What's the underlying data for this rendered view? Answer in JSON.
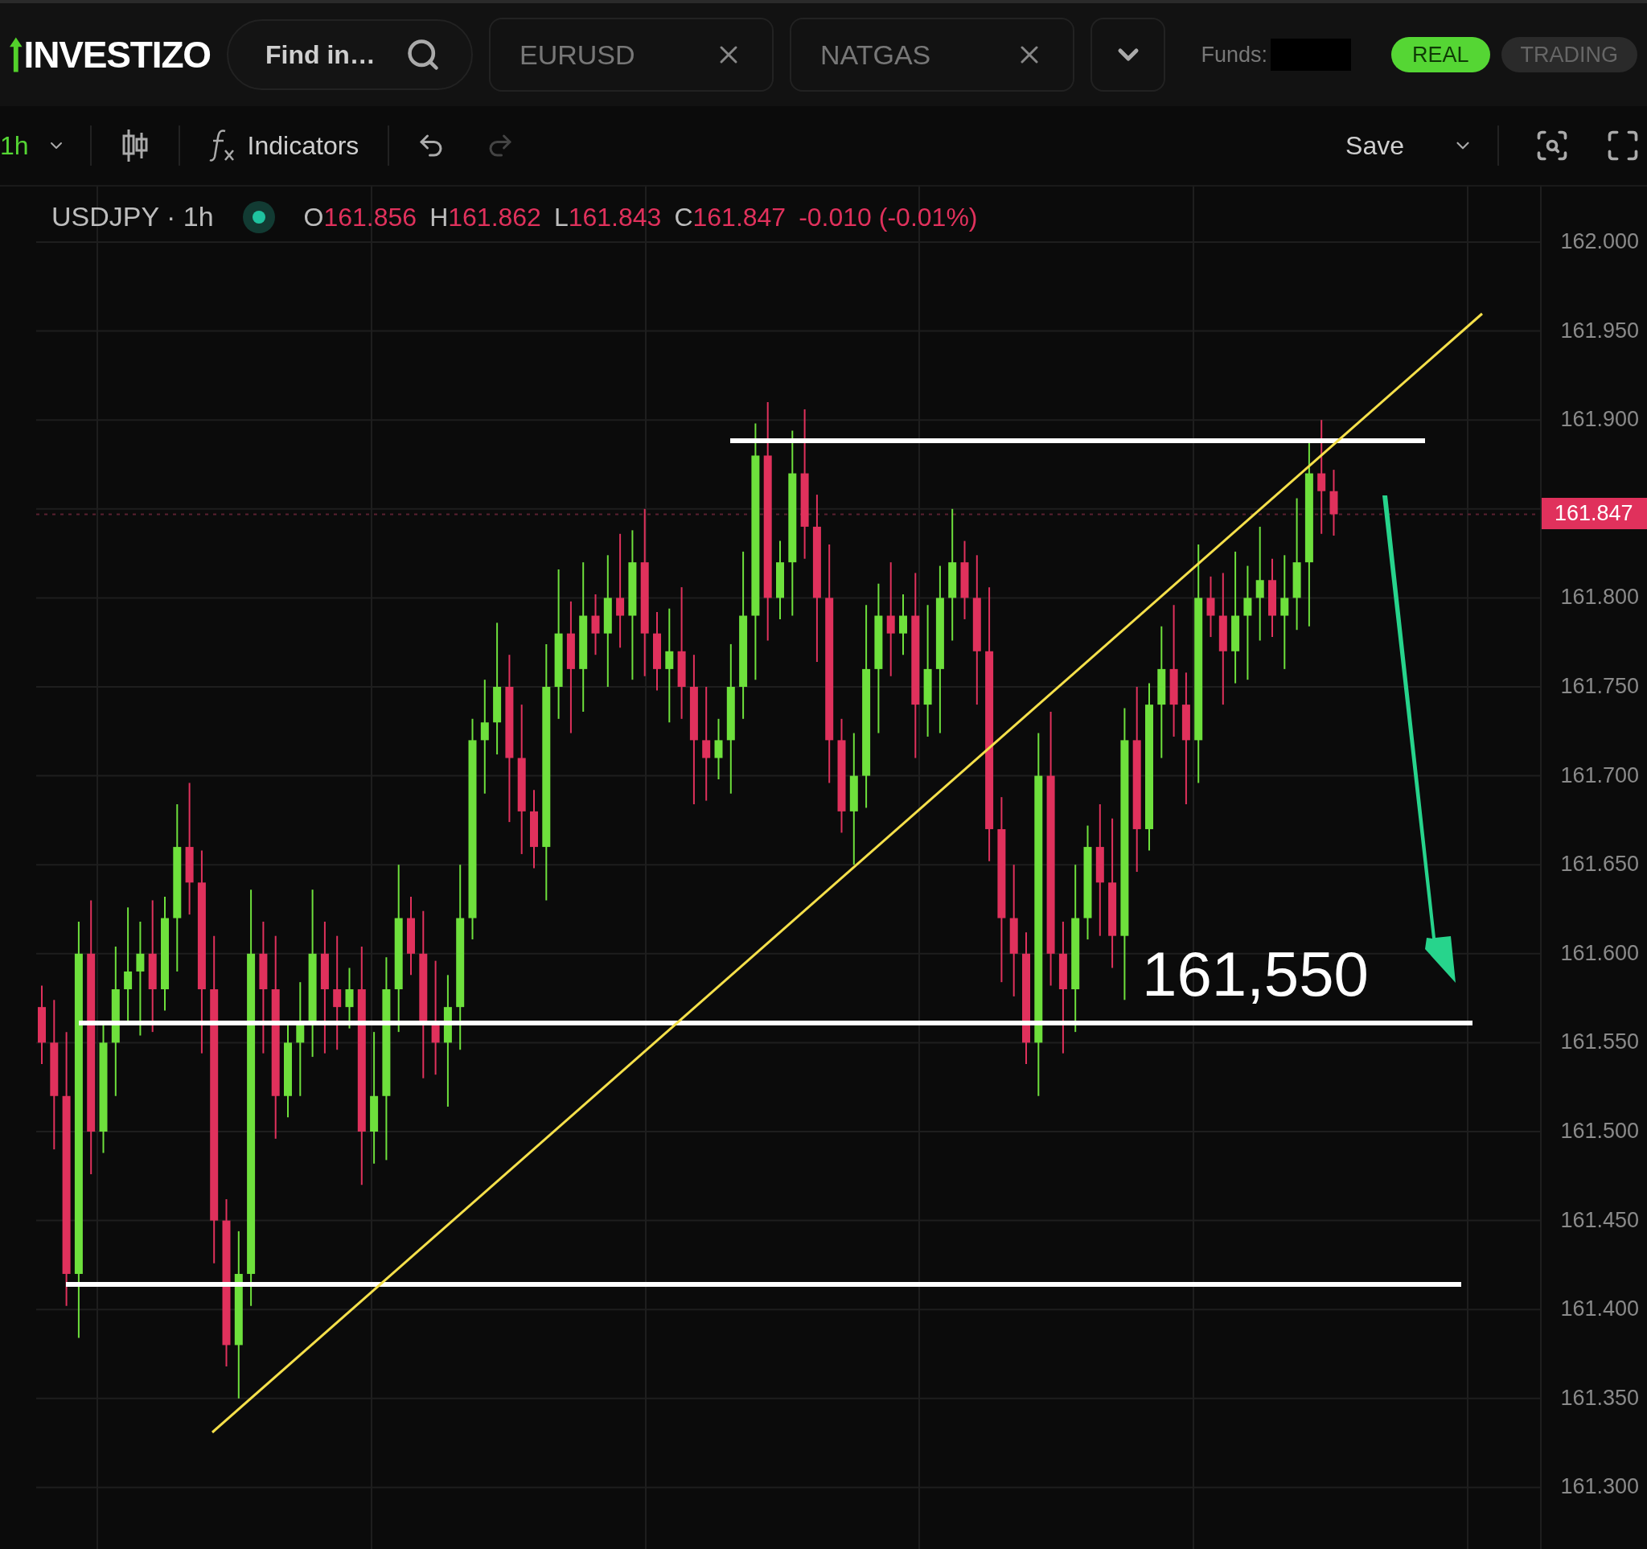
{
  "header": {
    "logo": "INVESTIZO",
    "search": {
      "placeholder": "Find in…"
    },
    "tabs": [
      {
        "label": "EURUSD"
      },
      {
        "label": "NATGAS"
      }
    ],
    "funds_label": "Funds:",
    "mode_toggle": [
      {
        "label": "REAL",
        "selected": true
      },
      {
        "label": "TRADING",
        "selected": false
      }
    ]
  },
  "toolbar": {
    "interval": "1h",
    "indicators": "Indicators",
    "save": "Save"
  },
  "legend": {
    "symbol": "USDJPY · 1h",
    "values": [
      {
        "key": "O",
        "value": "161.856"
      },
      {
        "key": "H",
        "value": "161.862"
      },
      {
        "key": "L",
        "value": "161.843"
      },
      {
        "key": "C",
        "value": "161.847"
      }
    ],
    "change": "-0.010 (-0.01%)"
  },
  "price_axis": {
    "ticks": [
      "162.000",
      "161.950",
      "161.900",
      "161.800",
      "161.750",
      "161.700",
      "161.650",
      "161.600",
      "161.550",
      "161.500",
      "161.450",
      "161.400",
      "161.350",
      "161.300"
    ],
    "current_price": "161.847"
  },
  "annotation": {
    "label": "161,550"
  }
}
